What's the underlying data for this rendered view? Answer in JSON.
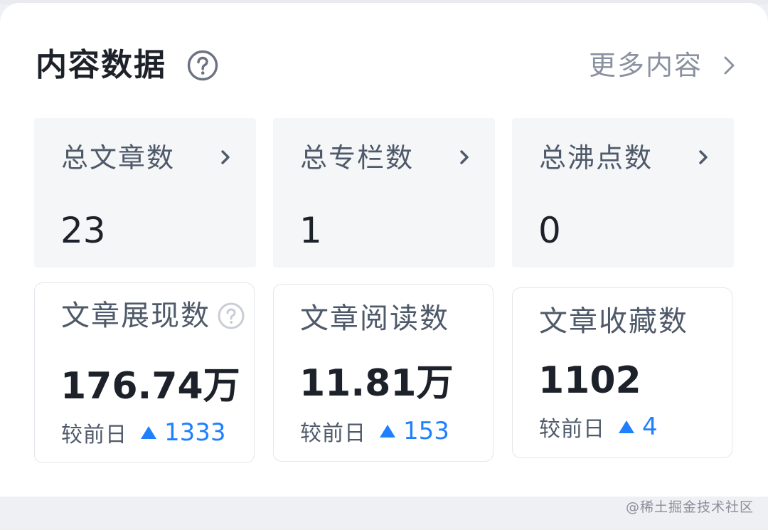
{
  "header": {
    "title": "内容数据",
    "more_label": "更多内容",
    "help_icon": "question-circle-icon",
    "more_icon": "chevron-right-icon"
  },
  "summary_tiles": [
    {
      "label": "总文章数",
      "value": "23"
    },
    {
      "label": "总专栏数",
      "value": "1"
    },
    {
      "label": "总沸点数",
      "value": "0"
    }
  ],
  "metrics": [
    {
      "label": "文章展现数",
      "value": "176.74万",
      "compare_label": "较前日",
      "delta": "1333",
      "has_help": true
    },
    {
      "label": "文章阅读数",
      "value": "11.81万",
      "compare_label": "较前日",
      "delta": "153",
      "has_help": false
    },
    {
      "label": "文章收藏数",
      "value": "1102",
      "compare_label": "较前日",
      "delta": "4",
      "has_help": false
    }
  ],
  "watermark": "@稀土掘金技术社区",
  "colors": {
    "accent": "#1e80ff",
    "title_text": "#1d2129",
    "secondary_text": "#4e5969",
    "muted_text": "#8a919f",
    "tile_background": "#f5f6f8",
    "card_border": "#e5e6eb"
  }
}
